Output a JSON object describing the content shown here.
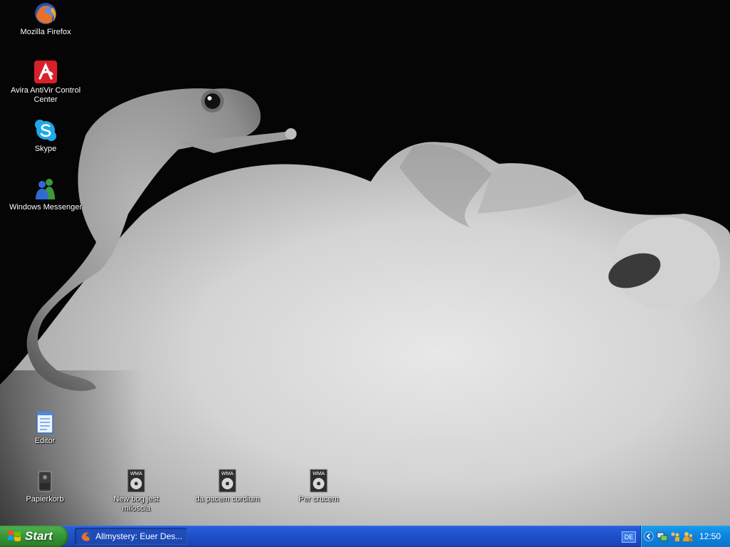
{
  "desktop": {
    "icons": [
      {
        "label": "Mozilla Firefox",
        "icon": "firefox-icon"
      },
      {
        "label": "Avira AntiVir Control Center",
        "icon": "avira-icon"
      },
      {
        "label": "Skype",
        "icon": "skype-icon"
      },
      {
        "label": "Windows Messenger",
        "icon": "windows-messenger-icon"
      },
      {
        "label": "Editor",
        "icon": "notepad-icon"
      },
      {
        "label": "Papierkorb",
        "icon": "recycle-bin-icon"
      },
      {
        "label": "New bog jest miloscia",
        "icon": "wma-file-icon"
      },
      {
        "label": "da pacem cordium",
        "icon": "wma-file-icon"
      },
      {
        "label": "Per crucem",
        "icon": "wma-file-icon"
      }
    ],
    "wma_badge": "WMA"
  },
  "taskbar": {
    "start_label": "Start",
    "task": {
      "label": "Allmystery: Euer Des...",
      "icon": "firefox-icon"
    },
    "language": "DE",
    "tray_icons": [
      "chevron-left-icon",
      "network-icon",
      "users-icon",
      "messenger-icon"
    ],
    "clock": "12:50"
  },
  "colors": {
    "taskbar_blue": "#245edb",
    "start_green": "#3c9a3c",
    "tray_blue": "#0f86e0"
  }
}
